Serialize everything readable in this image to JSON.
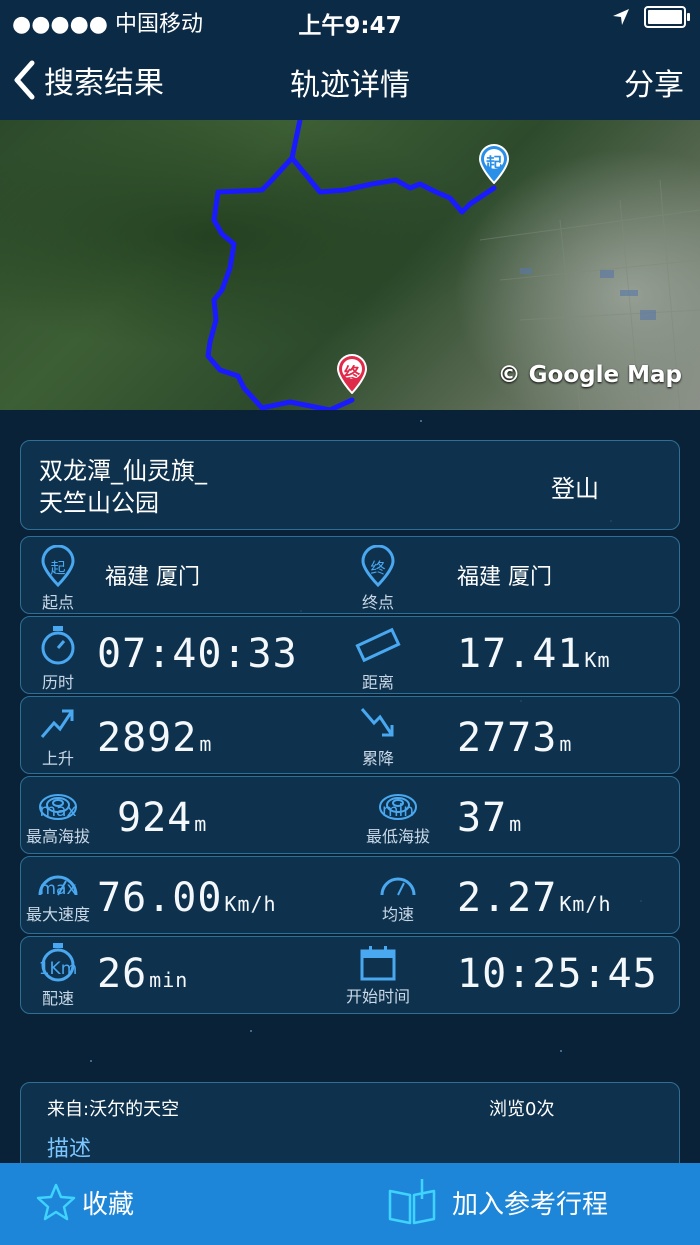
{
  "status": {
    "carrier": "●●●●● 中国移动",
    "time": "上午9:47"
  },
  "nav": {
    "back_label": "搜索结果",
    "title": "轨迹详情",
    "share_label": "分享"
  },
  "map": {
    "start_marker": "起",
    "end_marker": "终",
    "attribution": "© Google Map",
    "route_color": "#1a1aff"
  },
  "track": {
    "name": "双龙潭_仙灵旗_天竺山公园",
    "name_line1": "双龙潭_仙灵旗_",
    "name_line2": "天竺山公园",
    "type": "登山"
  },
  "stats": {
    "start": {
      "label": "起点",
      "icon_text": "起",
      "value": "福建 厦门"
    },
    "end": {
      "label": "终点",
      "icon_text": "终",
      "value": "福建 厦门"
    },
    "duration": {
      "label": "历时",
      "value": "07:40:33"
    },
    "distance": {
      "label": "距离",
      "value": "17.41",
      "unit": "Km"
    },
    "ascent": {
      "label": "上升",
      "value": "2892",
      "unit": "m"
    },
    "descent": {
      "label": "累降",
      "value": "2773",
      "unit": "m"
    },
    "max_alt": {
      "label": "最高海拔",
      "icon_text": "max",
      "value": "924",
      "unit": "m"
    },
    "min_alt": {
      "label": "最低海拔",
      "icon_text": "min",
      "value": "37",
      "unit": "m"
    },
    "max_speed": {
      "label": "最大速度",
      "icon_text": "max",
      "value": "76.00",
      "unit": "Km/h"
    },
    "avg_speed": {
      "label": "均速",
      "value": "2.27",
      "unit": "Km/h"
    },
    "pace": {
      "label": "配速",
      "icon_text": "1Km",
      "value": "26",
      "unit": "min"
    },
    "start_time": {
      "label": "开始时间",
      "value": "10:25:45"
    }
  },
  "info": {
    "from": "来自:沃尔的天空",
    "views": "浏览0次",
    "desc_label": "描述"
  },
  "actions": {
    "favorite": "收藏",
    "add_plan": "加入参考行程"
  },
  "colors": {
    "bg": "#0a2238",
    "accent": "#1e86d8",
    "icon": "#4aa8f0",
    "start_pin": "#2b8fe8",
    "end_pin": "#e02a4a"
  }
}
